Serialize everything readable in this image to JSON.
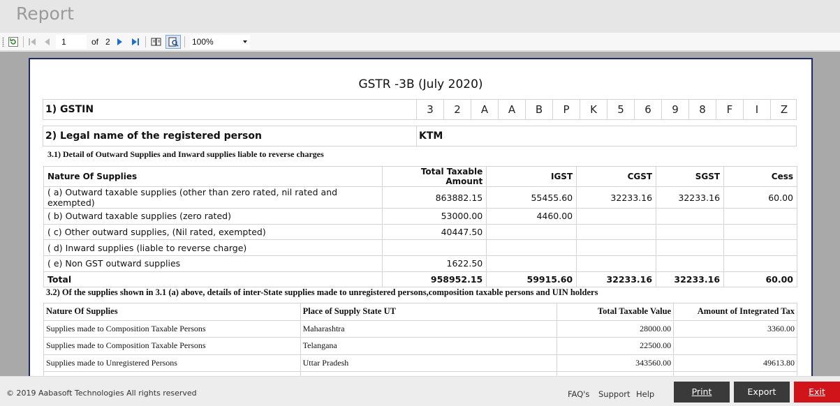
{
  "window": {
    "title": "Report"
  },
  "toolbar": {
    "current_page": "1",
    "of_label": "of",
    "total_pages": "2",
    "zoom": "100%"
  },
  "report": {
    "title": "GSTR -3B (July 2020)",
    "gstin_label": "1) GSTIN",
    "gstin_chars": [
      "3",
      "2",
      "A",
      "A",
      "B",
      "P",
      "K",
      "5",
      "6",
      "9",
      "8",
      "F",
      "I",
      "Z"
    ],
    "legal_label": "2) Legal name of the registered person",
    "legal_name": "KTM",
    "section31": {
      "title": "3.1) Detail of Outward Supplies and Inward supplies liable to reverse charges",
      "headers": [
        "Nature Of Supplies",
        "Total Taxable Amount",
        "IGST",
        "CGST",
        "SGST",
        "Cess"
      ],
      "rows": [
        [
          "( a) Outward taxable supplies (other than zero rated, nil rated and exempted)",
          "863882.15",
          "55455.60",
          "32233.16",
          "32233.16",
          "60.00"
        ],
        [
          "( b) Outward taxable supplies (zero rated)",
          "53000.00",
          "4460.00",
          "",
          "",
          ""
        ],
        [
          "( c) Other outward supplies, (Nil rated, exempted)",
          "40447.50",
          "",
          "",
          "",
          ""
        ],
        [
          "( d) Inward supplies (liable to reverse charge)",
          "",
          "",
          "",
          "",
          ""
        ],
        [
          "( e) Non GST outward supplies",
          "1622.50",
          "",
          "",
          "",
          ""
        ]
      ],
      "total": [
        "Total",
        "958952.15",
        "59915.60",
        "32233.16",
        "32233.16",
        "60.00"
      ]
    },
    "section32": {
      "title": "3.2) Of the supplies shown in 3.1 (a) above, details of inter-State supplies made to unregistered persons,composition taxable persons and UIN holders",
      "headers": [
        "Nature Of Supplies",
        "Place of Supply State UT",
        "Total Taxable Value",
        "Amount of Integrated Tax"
      ],
      "rows": [
        [
          "Supplies made to Composition Taxable Persons",
          "Maharashtra",
          "28000.00",
          "3360.00"
        ],
        [
          "Supplies made to Composition Taxable Persons",
          "Telangana",
          "22500.00",
          ""
        ],
        [
          "Supplies made to Unregistered Persons",
          "Uttar Pradesh",
          "343560.00",
          "49613.80"
        ]
      ]
    }
  },
  "footer": {
    "copyright": "© 2019 Aabasoft Technologies All rights reserved",
    "links": [
      "FAQ's",
      "Support",
      "Help"
    ],
    "print_label": "Print",
    "export_label": "Export",
    "exit_label": "Exit"
  },
  "colors": {
    "print_btn": "#3a3a3a",
    "export_btn": "#3a3a3a",
    "exit_btn": "#d0141a",
    "page_border": "#1c2a6d"
  }
}
